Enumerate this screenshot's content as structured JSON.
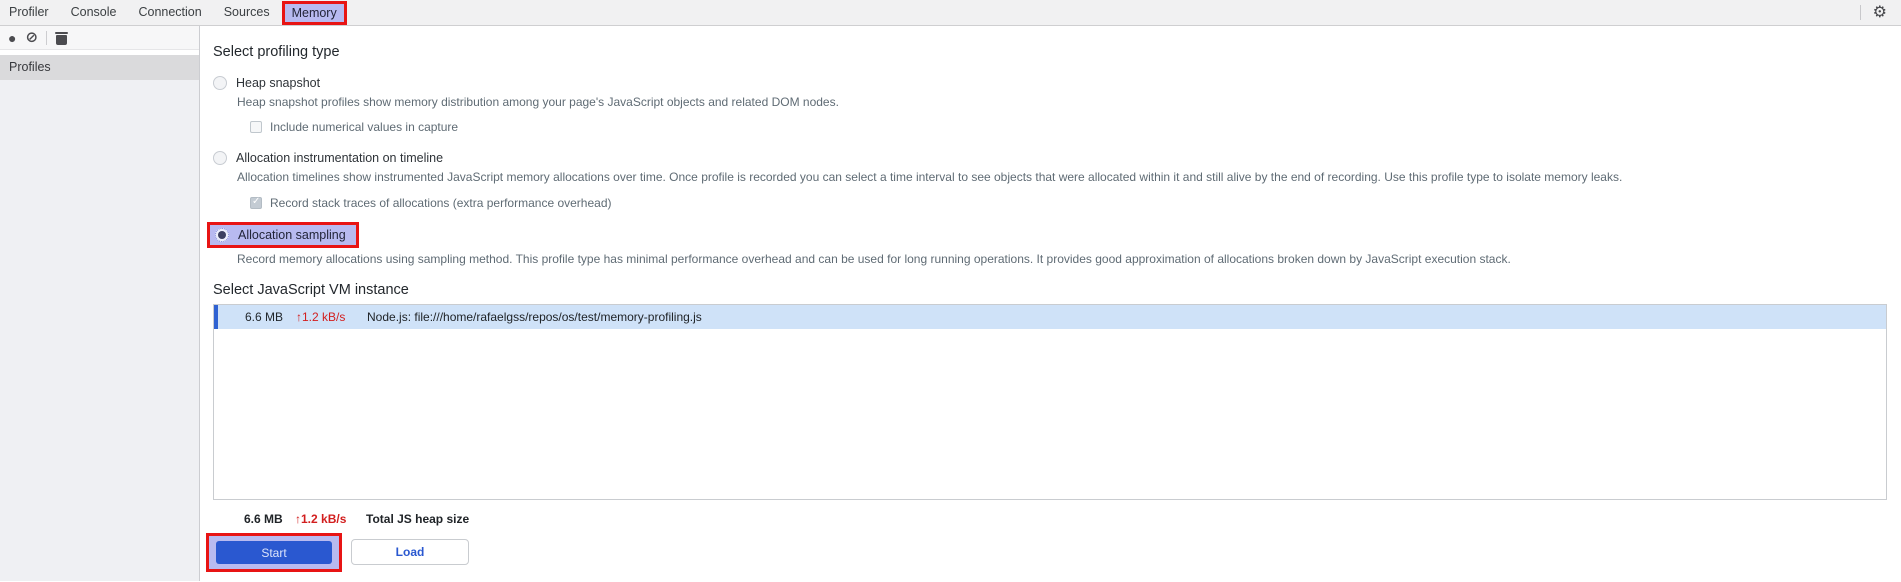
{
  "tabbar": {
    "tabs": [
      {
        "label": "Profiler",
        "active": false
      },
      {
        "label": "Console",
        "active": false
      },
      {
        "label": "Connection",
        "active": false
      },
      {
        "label": "Sources",
        "active": false
      },
      {
        "label": "Memory",
        "active": true
      }
    ]
  },
  "icons": {
    "settings_gear": "⚙",
    "record": "●",
    "clear_all": "⊘",
    "delete_trash": "trash-css-shape"
  },
  "sidebar": {
    "profiles_label": "Profiles"
  },
  "main": {
    "profiling_type": {
      "title": "Select profiling type",
      "options": [
        {
          "label": "Heap snapshot",
          "selected": false,
          "description": "Heap snapshot profiles show memory distribution among your page's JavaScript objects and related DOM nodes.",
          "checkbox": {
            "label": "Include numerical values in capture",
            "checked": false
          }
        },
        {
          "label": "Allocation instrumentation on timeline",
          "selected": false,
          "description": "Allocation timelines show instrumented JavaScript memory allocations over time. Once profile is recorded you can select a time interval to see objects that were allocated within it and still alive by the end of recording. Use this profile type to isolate memory leaks.",
          "checkbox": {
            "label": "Record stack traces of allocations (extra performance overhead)",
            "checked": true
          }
        },
        {
          "label": "Allocation sampling",
          "selected": true,
          "annotated": true,
          "description": "Record memory allocations using sampling method. This profile type has minimal performance overhead and can be used for long running operations. It provides good approximation of allocations broken down by JavaScript execution stack."
        }
      ]
    },
    "vm_instance": {
      "title": "Select JavaScript VM instance",
      "rows": [
        {
          "size": "6.6 MB",
          "rate": "↑1.2 kB/s",
          "name": "Node.js: file:///home/rafaelgss/repos/os/test/memory-profiling.js",
          "selected": true
        }
      ]
    },
    "footer": {
      "size": "6.6 MB",
      "rate": "↑1.2 kB/s",
      "label": "Total JS heap size"
    },
    "buttons": {
      "start": "Start",
      "load": "Load"
    }
  },
  "colors": {
    "annotation-red": "#e81414",
    "annotation-fill": "#b8baf0",
    "accent-blue": "#2a58d0",
    "row-selected-bg": "#cfe2f8",
    "row-selected-border": "#2f62d2",
    "rate-red": "#d21e1e"
  }
}
